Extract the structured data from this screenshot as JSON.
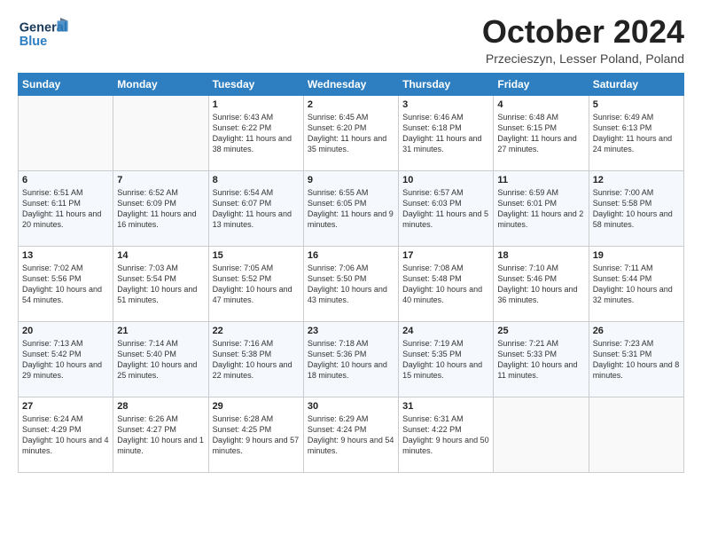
{
  "header": {
    "logo_line1": "General",
    "logo_line2": "Blue",
    "month": "October 2024",
    "location": "Przecieszyn, Lesser Poland, Poland"
  },
  "weekdays": [
    "Sunday",
    "Monday",
    "Tuesday",
    "Wednesday",
    "Thursday",
    "Friday",
    "Saturday"
  ],
  "weeks": [
    [
      {
        "day": "",
        "sunrise": "",
        "sunset": "",
        "daylight": ""
      },
      {
        "day": "",
        "sunrise": "",
        "sunset": "",
        "daylight": ""
      },
      {
        "day": "1",
        "sunrise": "Sunrise: 6:43 AM",
        "sunset": "Sunset: 6:22 PM",
        "daylight": "Daylight: 11 hours and 38 minutes."
      },
      {
        "day": "2",
        "sunrise": "Sunrise: 6:45 AM",
        "sunset": "Sunset: 6:20 PM",
        "daylight": "Daylight: 11 hours and 35 minutes."
      },
      {
        "day": "3",
        "sunrise": "Sunrise: 6:46 AM",
        "sunset": "Sunset: 6:18 PM",
        "daylight": "Daylight: 11 hours and 31 minutes."
      },
      {
        "day": "4",
        "sunrise": "Sunrise: 6:48 AM",
        "sunset": "Sunset: 6:15 PM",
        "daylight": "Daylight: 11 hours and 27 minutes."
      },
      {
        "day": "5",
        "sunrise": "Sunrise: 6:49 AM",
        "sunset": "Sunset: 6:13 PM",
        "daylight": "Daylight: 11 hours and 24 minutes."
      }
    ],
    [
      {
        "day": "6",
        "sunrise": "Sunrise: 6:51 AM",
        "sunset": "Sunset: 6:11 PM",
        "daylight": "Daylight: 11 hours and 20 minutes."
      },
      {
        "day": "7",
        "sunrise": "Sunrise: 6:52 AM",
        "sunset": "Sunset: 6:09 PM",
        "daylight": "Daylight: 11 hours and 16 minutes."
      },
      {
        "day": "8",
        "sunrise": "Sunrise: 6:54 AM",
        "sunset": "Sunset: 6:07 PM",
        "daylight": "Daylight: 11 hours and 13 minutes."
      },
      {
        "day": "9",
        "sunrise": "Sunrise: 6:55 AM",
        "sunset": "Sunset: 6:05 PM",
        "daylight": "Daylight: 11 hours and 9 minutes."
      },
      {
        "day": "10",
        "sunrise": "Sunrise: 6:57 AM",
        "sunset": "Sunset: 6:03 PM",
        "daylight": "Daylight: 11 hours and 5 minutes."
      },
      {
        "day": "11",
        "sunrise": "Sunrise: 6:59 AM",
        "sunset": "Sunset: 6:01 PM",
        "daylight": "Daylight: 11 hours and 2 minutes."
      },
      {
        "day": "12",
        "sunrise": "Sunrise: 7:00 AM",
        "sunset": "Sunset: 5:58 PM",
        "daylight": "Daylight: 10 hours and 58 minutes."
      }
    ],
    [
      {
        "day": "13",
        "sunrise": "Sunrise: 7:02 AM",
        "sunset": "Sunset: 5:56 PM",
        "daylight": "Daylight: 10 hours and 54 minutes."
      },
      {
        "day": "14",
        "sunrise": "Sunrise: 7:03 AM",
        "sunset": "Sunset: 5:54 PM",
        "daylight": "Daylight: 10 hours and 51 minutes."
      },
      {
        "day": "15",
        "sunrise": "Sunrise: 7:05 AM",
        "sunset": "Sunset: 5:52 PM",
        "daylight": "Daylight: 10 hours and 47 minutes."
      },
      {
        "day": "16",
        "sunrise": "Sunrise: 7:06 AM",
        "sunset": "Sunset: 5:50 PM",
        "daylight": "Daylight: 10 hours and 43 minutes."
      },
      {
        "day": "17",
        "sunrise": "Sunrise: 7:08 AM",
        "sunset": "Sunset: 5:48 PM",
        "daylight": "Daylight: 10 hours and 40 minutes."
      },
      {
        "day": "18",
        "sunrise": "Sunrise: 7:10 AM",
        "sunset": "Sunset: 5:46 PM",
        "daylight": "Daylight: 10 hours and 36 minutes."
      },
      {
        "day": "19",
        "sunrise": "Sunrise: 7:11 AM",
        "sunset": "Sunset: 5:44 PM",
        "daylight": "Daylight: 10 hours and 32 minutes."
      }
    ],
    [
      {
        "day": "20",
        "sunrise": "Sunrise: 7:13 AM",
        "sunset": "Sunset: 5:42 PM",
        "daylight": "Daylight: 10 hours and 29 minutes."
      },
      {
        "day": "21",
        "sunrise": "Sunrise: 7:14 AM",
        "sunset": "Sunset: 5:40 PM",
        "daylight": "Daylight: 10 hours and 25 minutes."
      },
      {
        "day": "22",
        "sunrise": "Sunrise: 7:16 AM",
        "sunset": "Sunset: 5:38 PM",
        "daylight": "Daylight: 10 hours and 22 minutes."
      },
      {
        "day": "23",
        "sunrise": "Sunrise: 7:18 AM",
        "sunset": "Sunset: 5:36 PM",
        "daylight": "Daylight: 10 hours and 18 minutes."
      },
      {
        "day": "24",
        "sunrise": "Sunrise: 7:19 AM",
        "sunset": "Sunset: 5:35 PM",
        "daylight": "Daylight: 10 hours and 15 minutes."
      },
      {
        "day": "25",
        "sunrise": "Sunrise: 7:21 AM",
        "sunset": "Sunset: 5:33 PM",
        "daylight": "Daylight: 10 hours and 11 minutes."
      },
      {
        "day": "26",
        "sunrise": "Sunrise: 7:23 AM",
        "sunset": "Sunset: 5:31 PM",
        "daylight": "Daylight: 10 hours and 8 minutes."
      }
    ],
    [
      {
        "day": "27",
        "sunrise": "Sunrise: 6:24 AM",
        "sunset": "Sunset: 4:29 PM",
        "daylight": "Daylight: 10 hours and 4 minutes."
      },
      {
        "day": "28",
        "sunrise": "Sunrise: 6:26 AM",
        "sunset": "Sunset: 4:27 PM",
        "daylight": "Daylight: 10 hours and 1 minute."
      },
      {
        "day": "29",
        "sunrise": "Sunrise: 6:28 AM",
        "sunset": "Sunset: 4:25 PM",
        "daylight": "Daylight: 9 hours and 57 minutes."
      },
      {
        "day": "30",
        "sunrise": "Sunrise: 6:29 AM",
        "sunset": "Sunset: 4:24 PM",
        "daylight": "Daylight: 9 hours and 54 minutes."
      },
      {
        "day": "31",
        "sunrise": "Sunrise: 6:31 AM",
        "sunset": "Sunset: 4:22 PM",
        "daylight": "Daylight: 9 hours and 50 minutes."
      },
      {
        "day": "",
        "sunrise": "",
        "sunset": "",
        "daylight": ""
      },
      {
        "day": "",
        "sunrise": "",
        "sunset": "",
        "daylight": ""
      }
    ]
  ]
}
